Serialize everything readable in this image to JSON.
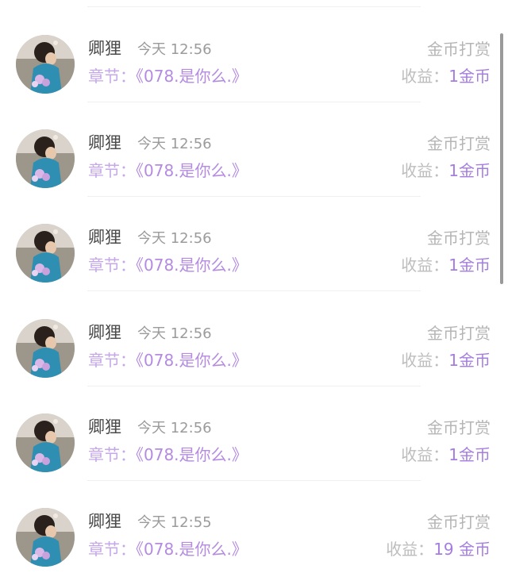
{
  "rows": [
    {
      "name": "卿狸",
      "time": "今天 12:56",
      "type": "金币打赏",
      "chapter_label": "章节：",
      "chapter_title": "《078.是你么.》",
      "income_label": "收益：",
      "income_value": "1金币"
    },
    {
      "name": "卿狸",
      "time": "今天 12:56",
      "type": "金币打赏",
      "chapter_label": "章节：",
      "chapter_title": "《078.是你么.》",
      "income_label": "收益：",
      "income_value": "1金币"
    },
    {
      "name": "卿狸",
      "time": "今天 12:56",
      "type": "金币打赏",
      "chapter_label": "章节：",
      "chapter_title": "《078.是你么.》",
      "income_label": "收益：",
      "income_value": "1金币"
    },
    {
      "name": "卿狸",
      "time": "今天 12:56",
      "type": "金币打赏",
      "chapter_label": "章节：",
      "chapter_title": "《078.是你么.》",
      "income_label": "收益：",
      "income_value": "1金币"
    },
    {
      "name": "卿狸",
      "time": "今天 12:56",
      "type": "金币打赏",
      "chapter_label": "章节：",
      "chapter_title": "《078.是你么.》",
      "income_label": "收益：",
      "income_value": "1金币"
    },
    {
      "name": "卿狸",
      "time": "今天 12:55",
      "type": "金币打赏",
      "chapter_label": "章节：",
      "chapter_title": "《078.是你么.》",
      "income_label": "收益：",
      "income_value": "19 金币"
    }
  ],
  "colors": {
    "chapter_text": "#b48be0",
    "income_value": "#a57ddf",
    "muted_text": "#b5b5b5",
    "name_text": "#4a4a4a"
  }
}
